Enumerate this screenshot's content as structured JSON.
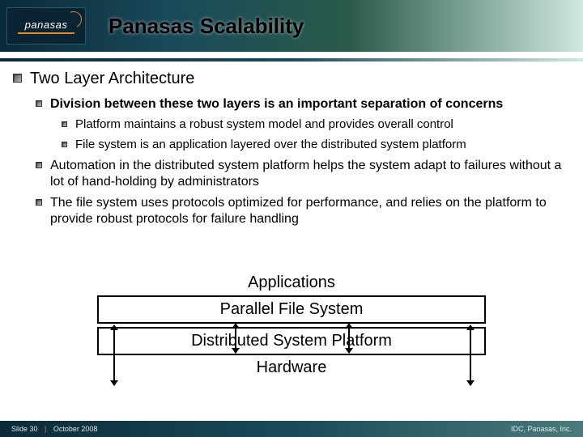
{
  "logo_text": "panasas",
  "title": "Panasas Scalability",
  "heading": "Two Layer Architecture",
  "sub1": "Division between these two layers is an important separation of concerns",
  "sub1a": "Platform maintains a robust system model and provides overall control",
  "sub1b": "File system is an application layered over the distributed system platform",
  "sub2": "Automation in the distributed system platform helps the system adapt to failures without a lot of hand-holding by administrators",
  "sub3": "The file system uses protocols optimized for performance, and relies on the platform to provide robust protocols for failure handling",
  "diagram": {
    "top": "Applications",
    "box1": "Parallel File System",
    "box2": "Distributed System Platform",
    "bottom": "Hardware"
  },
  "footer": {
    "slide": "Slide 30",
    "date": "October 2008",
    "right": "IDC, Panasas, Inc."
  }
}
